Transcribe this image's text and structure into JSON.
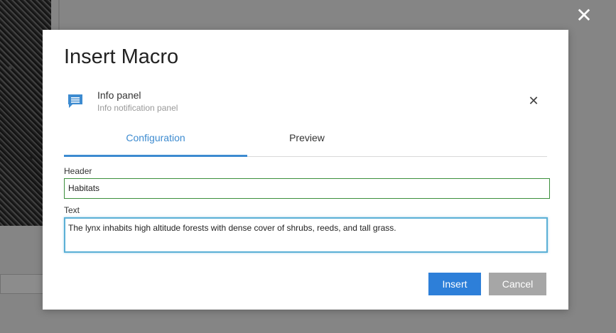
{
  "overlay": {
    "close_glyph": "✕"
  },
  "dialog": {
    "title": "Insert Macro",
    "macro": {
      "name": "Info panel",
      "description": "Info notification panel",
      "icon": "message-icon",
      "remove_glyph": "✕"
    },
    "tabs": [
      {
        "label": "Configuration",
        "active": true
      },
      {
        "label": "Preview",
        "active": false
      }
    ],
    "fields": {
      "header": {
        "label": "Header",
        "value": "Habitats"
      },
      "text": {
        "label": "Text",
        "value": "The lynx inhabits high altitude forests with dense cover of shrubs, reeds, and tall grass."
      }
    },
    "buttons": {
      "insert": "Insert",
      "cancel": "Cancel"
    }
  },
  "colors": {
    "accent": "#3d8bd0",
    "insert_button": "#2d7fd9",
    "cancel_button": "#a6a6a6",
    "header_border": "#3b8f3b",
    "text_focus_border": "#5bb0d6"
  }
}
